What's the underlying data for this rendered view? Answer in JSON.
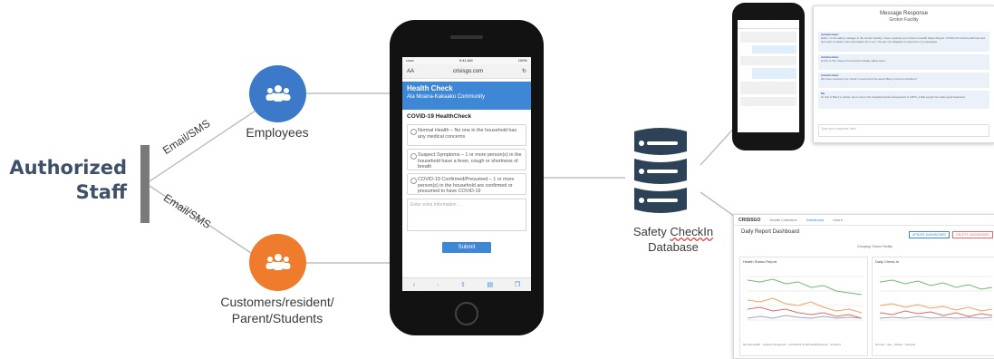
{
  "left": {
    "authorized_staff": [
      "Authorized",
      "Staff"
    ],
    "edge_top": "Email/SMS",
    "edge_bottom": "Email/SMS"
  },
  "nodes": {
    "employees": {
      "label": "Employees",
      "color": "#3c79c8",
      "icon": "group-icon"
    },
    "customers": {
      "label_lines": [
        "Customers/resident/",
        "Parent/Students"
      ],
      "color": "#ee7c2c",
      "icon": "group-icon"
    }
  },
  "phone": {
    "status_left": "•••oo",
    "status_time": "9:41 AM",
    "status_right": "100%",
    "url_left": "AA",
    "url": "crisisgo.com",
    "header_title": "Health Check",
    "header_subtitle": "Ala Moana-Kakaako Community",
    "section_title": "COVID-19 HealthCheck",
    "options": [
      "Normal Health – No one in the household has any medical concerns",
      "Suspect Symptoms – 1 or more person(s) in the household have a fever, cough or shortness of breath",
      "COVID-19 Confirmed/Presumed – 1 or more person(s) in the household are confirmed or presumed to have COVID-19"
    ],
    "extra_placeholder": "Enter extra information ...",
    "submit_label": "Submit",
    "accent_color": "#3e86d6"
  },
  "database": {
    "caption_line1_a": "Safety ",
    "caption_line1_b": "CheckIn",
    "caption_line2": "Database",
    "color": "#2e4257"
  },
  "message_response": {
    "title": "Message Response",
    "subtitle": "Groton Facility",
    "messages": [
      {
        "sender": "Administrator",
        "text": "Hello, I'm the safety manager in the Groton Facility. I have received your check in Health Status Report: COVID-19 Confirmed/Presumed and want to obtain more information from you. You are not obligated to respond to my messages."
      },
      {
        "sender": "Administrator",
        "text": "Hi this is Tim Carson from Groton Facility safety team."
      },
      {
        "sender": "Administrator",
        "text": "We have received your check in result and how about Barry's current condition?"
      },
      {
        "sender": "Me",
        "text": "Hi, this is Barry's mother. He is now in the hospital and the temperature is 100°F, a little cough but under good treatment."
      }
    ],
    "input_placeholder": "Type your response here"
  },
  "dashboard": {
    "logo": "CRISISGO",
    "nav": [
      "Health Collection",
      "Dashboard",
      "Users"
    ],
    "title": "Daily Report Dashboard",
    "buttons": [
      "UPDATE DASHBOARD",
      "DELETE DASHBOARD"
    ],
    "filter_label": "Grouping:",
    "filter_value": "Groton Facility",
    "panel_left_title": "Health Status Report",
    "panel_right_title": "Daily Check-In",
    "legend_left": [
      "Normal Health",
      "Suspect Symptoms",
      "COVID-19 Confirmed/Presumed",
      "Unreport"
    ],
    "legend_right": [
      "Normal",
      "Late",
      "Absent",
      "Unreport"
    ],
    "series_colors": [
      "#6bbf73",
      "#f3a35c",
      "#e46a6a",
      "#9aa7b5"
    ]
  }
}
